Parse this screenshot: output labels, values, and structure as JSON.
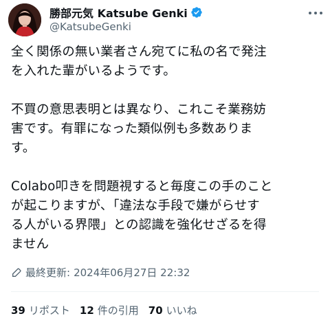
{
  "author": {
    "display_name": "勝部元気 Katsube Genki",
    "handle": "@KatsubeGenki",
    "verified_color": "#1d9bf0"
  },
  "tweet": {
    "paragraphs": [
      [
        "全く関係の無い業者さん宛てに私の名で発注",
        "を入れた輩がいるようです。"
      ],
      [
        "不買の意思表明とは異なり、これこそ業務妨",
        "害です。有罪になった類似例も多数ありま",
        "す。"
      ],
      [
        "Colabo叩きを問題視すると毎度この手のこと",
        "が起こりますが、「違法な手段で嫌がらせす",
        "る人がいる界隈」との認識を強化せざるを得",
        "ません"
      ]
    ]
  },
  "meta": {
    "edited_label": "最終更新:",
    "timestamp": "2024年06月27日 22:32",
    "icon": "edit-history-icon"
  },
  "stats": {
    "reposts_count": "39",
    "reposts_label": "リポスト",
    "quotes_count": "12",
    "quotes_label": "件の引用",
    "likes_count": "70",
    "likes_label": "いいね"
  }
}
